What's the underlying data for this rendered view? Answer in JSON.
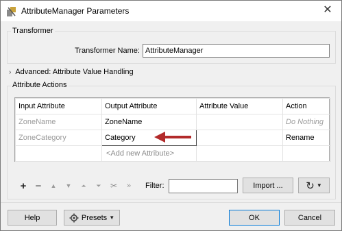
{
  "window": {
    "title": "AttributeManager Parameters",
    "close_glyph": "✕"
  },
  "transformer": {
    "group_title": "Transformer",
    "name_label": "Transformer Name:",
    "name_value": "AttributeManager"
  },
  "advanced": {
    "label": "Advanced: Attribute Value Handling",
    "expanded": false
  },
  "actions": {
    "group_title": "Attribute Actions",
    "columns": [
      "Input Attribute",
      "Output Attribute",
      "Attribute Value",
      "Action"
    ],
    "rows": [
      {
        "input": "ZoneName",
        "output": "ZoneName",
        "value": "",
        "action": "Do Nothing"
      },
      {
        "input": "ZoneCategory",
        "output": "Category",
        "value": "",
        "action": "Rename"
      }
    ],
    "add_hint": "<Add new Attribute>"
  },
  "toolbar": {
    "filter_label": "Filter:",
    "filter_value": "",
    "import_label": "Import ...",
    "icons": [
      "plus-icon",
      "minus-icon",
      "move-up-icon",
      "move-down-icon",
      "move-top-icon",
      "move-bottom-icon",
      "cut-icon",
      "expand-icon",
      "refresh-icon"
    ]
  },
  "footer": {
    "help_label": "Help",
    "presets_label": "Presets",
    "ok_label": "OK",
    "cancel_label": "Cancel"
  },
  "colors": {
    "annotation_arrow": "#b22a2a",
    "focus_border": "#0078d7"
  }
}
